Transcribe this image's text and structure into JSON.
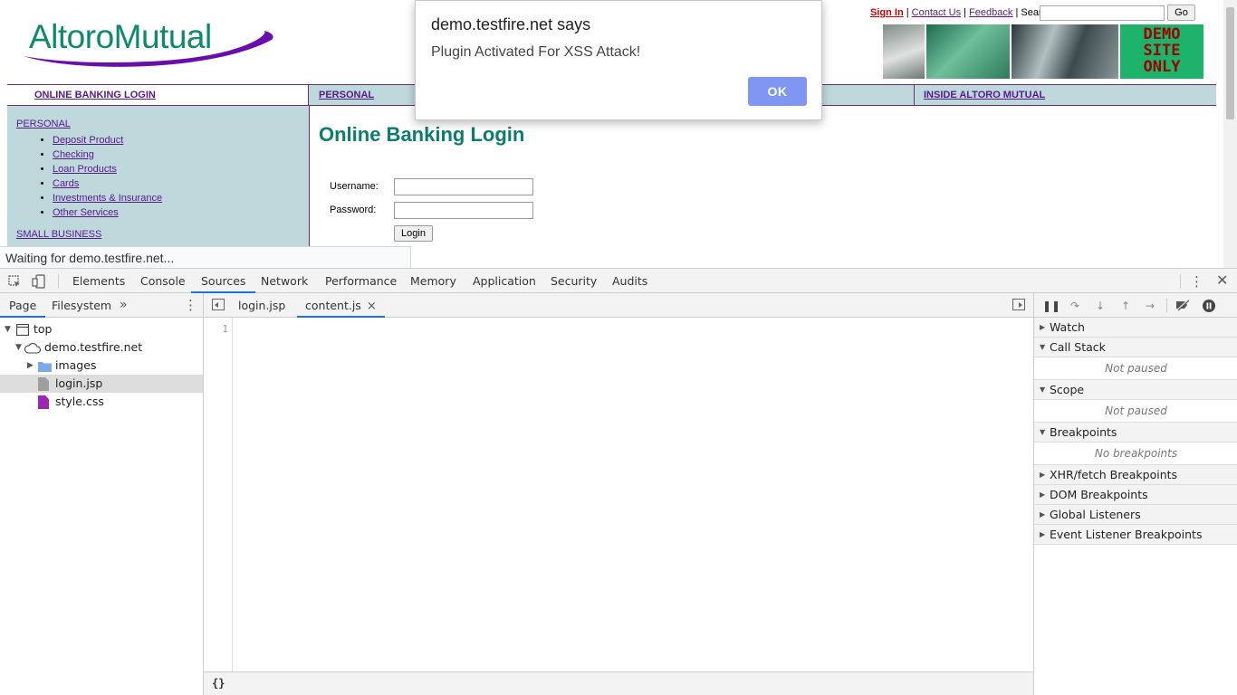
{
  "page": {
    "logo_text": "AltoroMutual",
    "top_links": {
      "sign_in": "Sign In",
      "contact_us": "Contact Us",
      "feedback": "Feedback",
      "search_label": "Search",
      "sep": "|"
    },
    "search": {
      "value": "",
      "go_label": "Go"
    },
    "banner": {
      "demo_text": [
        "DEMO",
        "SITE",
        "ONLY"
      ]
    },
    "nav": {
      "online_banking_login": "ONLINE BANKING LOGIN",
      "personal": "PERSONAL",
      "inside_altoro": "INSIDE ALTORO MUTUAL"
    },
    "sidebar": {
      "personal_heading": "PERSONAL",
      "items": [
        "Deposit Product",
        "Checking",
        "Loan Products",
        "Cards",
        "Investments & Insurance",
        "Other Services"
      ],
      "small_business_heading": "SMALL BUSINESS"
    },
    "login": {
      "title": "Online Banking Login",
      "username_label": "Username:",
      "password_label": "Password:",
      "username_value": "",
      "password_value": "",
      "button_label": "Login"
    },
    "status_text": "Waiting for demo.testfire.net..."
  },
  "alert": {
    "title": "demo.testfire.net says",
    "message": "Plugin Activated For XSS Attack!",
    "ok_label": "OK",
    "ok_color": "#7f96f2"
  },
  "devtools": {
    "tabs": [
      "Elements",
      "Console",
      "Sources",
      "Network",
      "Performance",
      "Memory",
      "Application",
      "Security",
      "Audits"
    ],
    "active_tab": "Sources",
    "navigator": {
      "tabs": [
        "Page",
        "Filesystem"
      ],
      "more_icon": "»",
      "tree": {
        "top": "top",
        "domain": "demo.testfire.net",
        "folder": "images",
        "files": [
          "login.jsp",
          "style.css"
        ],
        "selected": "login.jsp"
      }
    },
    "editor": {
      "tabs": [
        "login.jsp",
        "content.js"
      ],
      "active_tab": "content.js",
      "close_glyph": "×",
      "line_numbers": [
        "1"
      ],
      "pretty_print_label": "{}"
    },
    "debugger": {
      "sections": {
        "watch": "Watch",
        "call_stack": "Call Stack",
        "call_stack_body": "Not paused",
        "scope": "Scope",
        "scope_body": "Not paused",
        "breakpoints": "Breakpoints",
        "breakpoints_body": "No breakpoints",
        "xhr": "XHR/fetch Breakpoints",
        "dom": "DOM Breakpoints",
        "global": "Global Listeners",
        "event": "Event Listener Breakpoints"
      }
    },
    "accent_color": "#1a73e8"
  }
}
